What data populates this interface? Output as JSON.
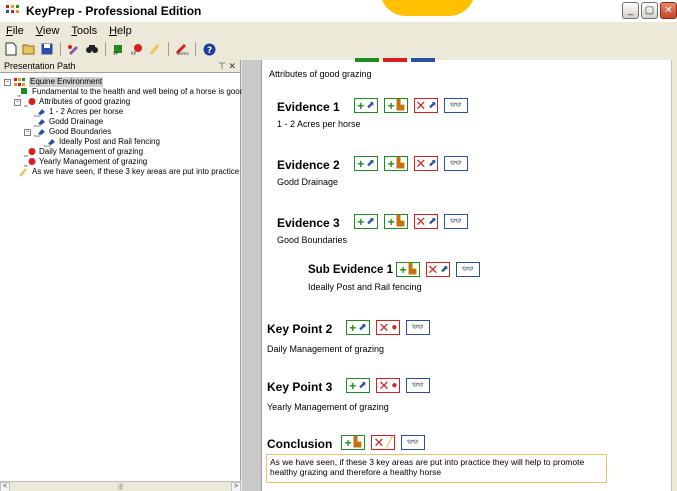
{
  "window": {
    "title": "KeyPrep - Professional Edition",
    "controls": [
      "_",
      "▢",
      "✕"
    ]
  },
  "menu": {
    "items": [
      {
        "u": "F",
        "rest": "ile"
      },
      {
        "u": "V",
        "rest": "iew"
      },
      {
        "u": "T",
        "rest": "ools"
      },
      {
        "u": "H",
        "rest": "elp"
      }
    ]
  },
  "left_panel": {
    "title": "Presentation Path",
    "pin": "⊤ ✕",
    "tree": [
      {
        "label": "Equine Environment",
        "level": 0,
        "icon": "presentation-icon",
        "expander": "−",
        "selected": true
      },
      {
        "label": "Fundamental to the health and well being of a horse is good",
        "level": 1,
        "icon": "intro-icon"
      },
      {
        "label": "Attributes of good grazing",
        "level": 1,
        "icon": "keypoint-icon",
        "expander": "−"
      },
      {
        "label": "1 - 2 Acres per horse",
        "level": 2,
        "icon": "evidence-icon"
      },
      {
        "label": "Godd Drainage",
        "level": 2,
        "icon": "evidence-icon"
      },
      {
        "label": "Good Boundaries",
        "level": 2,
        "icon": "evidence-icon",
        "expander": "−"
      },
      {
        "label": "Ideally Post and Rail fencing",
        "level": 3,
        "icon": "evidence-icon"
      },
      {
        "label": "Daily Management of grazing",
        "level": 1,
        "icon": "keypoint-icon"
      },
      {
        "label": "Yearly Management of grazing",
        "level": 1,
        "icon": "keypoint-icon"
      },
      {
        "label": "As we have seen, if these 3 key areas are put into practice t",
        "level": 1,
        "icon": "conclusion-icon"
      }
    ],
    "hscroll_left": "<",
    "hscroll_thumb": "|||",
    "hscroll_right": ">"
  },
  "document": {
    "intro_text": "Attributes of good grazing",
    "evidence1": {
      "heading": "Evidence 1",
      "text": "1 - 2 Acres per horse"
    },
    "evidence2": {
      "heading": "Evidence 2",
      "text": "Godd Drainage"
    },
    "evidence3": {
      "heading": "Evidence 3",
      "text": "Good Boundaries"
    },
    "sub_evidence1": {
      "heading": "Sub Evidence 1",
      "text": "Ideally Post and Rail fencing"
    },
    "keypoint2": {
      "heading": "Key Point 2",
      "text": "Daily Management of grazing"
    },
    "keypoint3": {
      "heading": "Key Point 3",
      "text": "Yearly Management of grazing"
    },
    "conclusion": {
      "heading": "Conclusion",
      "text": "As we have seen, if these 3 key areas are put into practice they will help to promote healthy grazing and therefore a healthy horse"
    }
  },
  "colors": {
    "add": "#1e8c1e",
    "delete": "#d81f1f",
    "find": "#2a4fa8",
    "banner": "#ffc000"
  }
}
